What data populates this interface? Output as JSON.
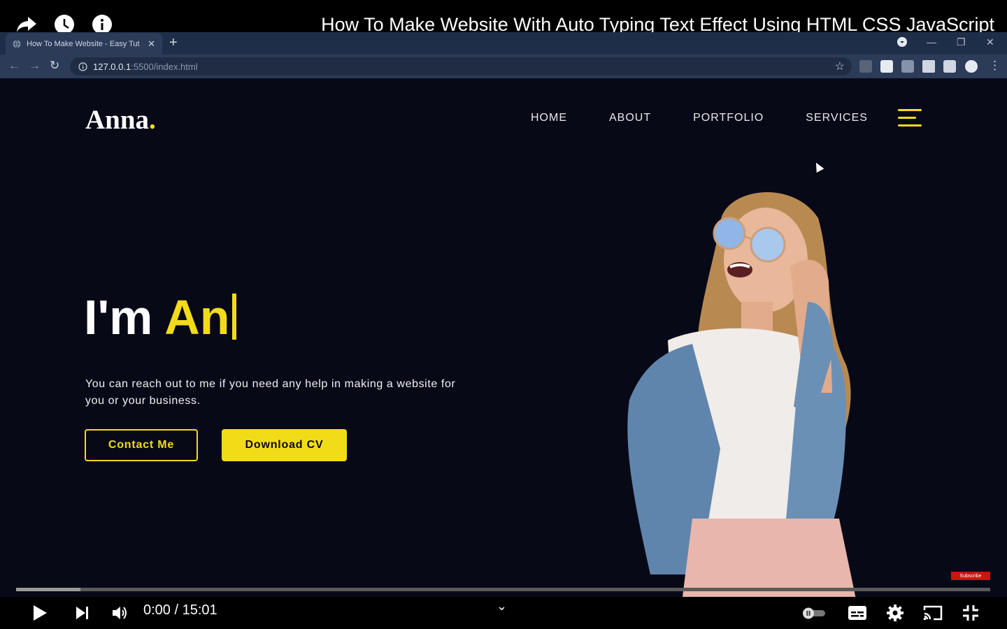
{
  "video": {
    "title": "How To Make Website With Auto Typing Text Effect Using HTML CSS JavaScript",
    "time": "0:00 / 15:01",
    "progress_fraction": 0.066,
    "subscribe_badge": "Subscribe"
  },
  "browser": {
    "tab_title": "How To Make Website - Easy Tut",
    "url_host": "127.0.0.1",
    "url_path": ":5500/index.html"
  },
  "site": {
    "logo_text": "Anna",
    "logo_dot": ".",
    "nav": [
      "HOME",
      "ABOUT",
      "PORTFOLIO",
      "SERVICES"
    ],
    "hero_prefix": "I'm ",
    "hero_typed": "An",
    "description": "You can reach out to me if you need any help in making a website for you or your business.",
    "btn_contact": "Contact Me",
    "btn_download": "Download CV"
  },
  "colors": {
    "accent": "#f2dc18",
    "site_bg": "#080917",
    "chrome_bg": "#1f2e48"
  },
  "icons": [
    "share-icon",
    "watch-later-icon",
    "info-icon",
    "play-icon",
    "next-icon",
    "volume-icon",
    "autoplay-toggle-icon",
    "captions-icon",
    "settings-icon",
    "cast-icon",
    "exit-fullscreen-icon",
    "hamburger-menu-icon"
  ]
}
